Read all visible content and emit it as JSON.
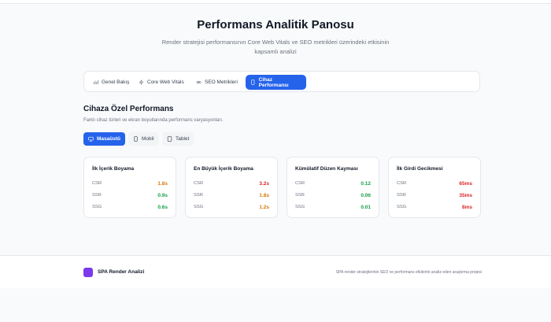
{
  "header": {
    "title": "Performans Analitik Panosu",
    "subtitle": "Render stratejisi performansının Core Web Vitals ve SEO metrikleri üzerindeki etkisinin kapsamlı analizi"
  },
  "tabs": [
    {
      "label": "Genel Bakış",
      "icon": "bar-chart-icon",
      "active": false
    },
    {
      "label": "Core Web Vitals",
      "icon": "zap-icon",
      "active": false
    },
    {
      "label": "SEO Metrikleri",
      "icon": "eye-icon",
      "active": false
    },
    {
      "label": "Cihaz Performansı",
      "icon": "smartphone-icon",
      "active": true
    }
  ],
  "section": {
    "title": "Cihaza Özel Performans",
    "subtitle": "Farklı cihaz türleri ve ekran boyutlarında performans varyasyonları."
  },
  "devices": [
    {
      "label": "Masaüstü",
      "icon": "monitor-icon",
      "active": true
    },
    {
      "label": "Mobil",
      "icon": "smartphone-icon",
      "active": false
    },
    {
      "label": "Tablet",
      "icon": "tablet-icon",
      "active": false
    }
  ],
  "colors": {
    "accent": "#2563eb",
    "good": "#16a34a",
    "warn": "#d97706",
    "bad": "#dc2626",
    "brand": "#7c3aed"
  },
  "metrics": [
    {
      "title": "İlk İçerik Boyama",
      "rows": [
        {
          "label": "CSR",
          "value": "1.8s",
          "status": "warn"
        },
        {
          "label": "SSR",
          "value": "0.9s",
          "status": "good"
        },
        {
          "label": "SSG",
          "value": "0.6s",
          "status": "good"
        }
      ]
    },
    {
      "title": "En Büyük İçerik Boyama",
      "rows": [
        {
          "label": "CSR",
          "value": "3.2s",
          "status": "bad"
        },
        {
          "label": "SSR",
          "value": "1.8s",
          "status": "warn"
        },
        {
          "label": "SSG",
          "value": "1.2s",
          "status": "warn"
        }
      ]
    },
    {
      "title": "Kümülatif Düzen Kayması",
      "rows": [
        {
          "label": "CSR",
          "value": "0.12",
          "status": "good"
        },
        {
          "label": "SSR",
          "value": "0.06",
          "status": "good"
        },
        {
          "label": "SSG",
          "value": "0.01",
          "status": "good"
        }
      ]
    },
    {
      "title": "İlk Girdi Gecikmesi",
      "rows": [
        {
          "label": "CSR",
          "value": "65ms",
          "status": "bad"
        },
        {
          "label": "SSR",
          "value": "35ms",
          "status": "bad"
        },
        {
          "label": "SSG",
          "value": "8ms",
          "status": "bad"
        }
      ]
    }
  ],
  "footer": {
    "brand": "SPA Render Analizi",
    "note": "SPA render stratejilerinin SEO ve performans etkilerini analiz eden araştırma projesi"
  }
}
